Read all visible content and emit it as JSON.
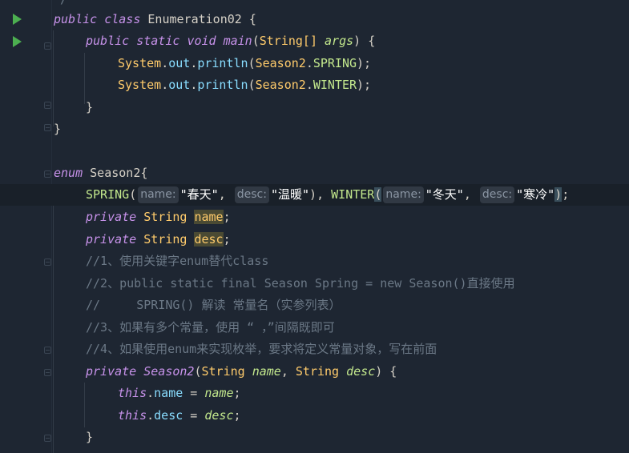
{
  "editor": {
    "top_partial": "*/",
    "lines": {
      "l1": {
        "kw1": "public",
        "kw2": "class",
        "name": "Enumeration02",
        "brace": " {"
      },
      "l2": {
        "kw1": "public",
        "kw2": "static",
        "kw3": "void",
        "fn": "main",
        "open": "(",
        "type": "String[]",
        "param": "args",
        "close": ") {"
      },
      "l3": {
        "cls": "System",
        "dot1": ".",
        "out": "out",
        "dot2": ".",
        "println": "println",
        "open": "(",
        "arg_cls": "Season2",
        "dot3": ".",
        "arg": "SPRING",
        "close": ");"
      },
      "l4": {
        "cls": "System",
        "dot1": ".",
        "out": "out",
        "dot2": ".",
        "println": "println",
        "open": "(",
        "arg_cls": "Season2",
        "dot3": ".",
        "arg": "WINTER",
        "close": ");"
      },
      "l5": {
        "brace": "}"
      },
      "l6": {
        "brace": "}"
      },
      "l8": {
        "kw": "enum",
        "name": "Season2",
        "brace": "{"
      },
      "l9": {
        "c1": "SPRING",
        "p1": "(",
        "h1": "name:",
        "s1": "\"春天\"",
        "comma1": ", ",
        "h2": "desc:",
        "s2": "\"温暖\"",
        "p2": "), ",
        "c2": "WINTER",
        "p3": "(",
        "h3": "name:",
        "s3": "\"冬天\"",
        "comma2": ", ",
        "h4": "desc:",
        "s4": "\"寒冷\"",
        "p4": ")",
        "semi": ";"
      },
      "l10": {
        "kw": "private",
        "type": "String",
        "field": "name",
        "semi": ";"
      },
      "l11": {
        "kw": "private",
        "type": "String",
        "field": "desc",
        "semi": ";"
      },
      "l12": {
        "comment": "//1、使用关键字enum替代class"
      },
      "l13": {
        "comment": "//2、public static final Season Spring = new Season()直接使用"
      },
      "l14": {
        "comment": "//     SPRING() 解读 常量名（实参列表）"
      },
      "l15": {
        "comment": "//3、如果有多个常量，使用 “ ，”间隔既即可"
      },
      "l16": {
        "comment": "//4、如果使用enum来实现枚举，要求将定义常量对象，写在前面"
      },
      "l17": {
        "kw": "private",
        "name": "Season2",
        "open": "(",
        "t1": "String",
        "p1": "name",
        "comma": ", ",
        "t2": "String",
        "p2": "desc",
        "close": ") {"
      },
      "l18": {
        "this": "this",
        "dot": ".",
        "field": "name",
        "eq": " = ",
        "val": "name",
        "semi": ";"
      },
      "l19": {
        "this": "this",
        "dot": ".",
        "field": "desc",
        "eq": " = ",
        "val": "desc",
        "semi": ";"
      },
      "l20": {
        "brace": "}"
      }
    },
    "colors": {
      "background": "#1e2632",
      "keyword": "#c792ea",
      "type": "#ffcb6b",
      "constant": "#c3e88d",
      "comment": "#6b7886",
      "run_icon": "#4caf50"
    }
  }
}
